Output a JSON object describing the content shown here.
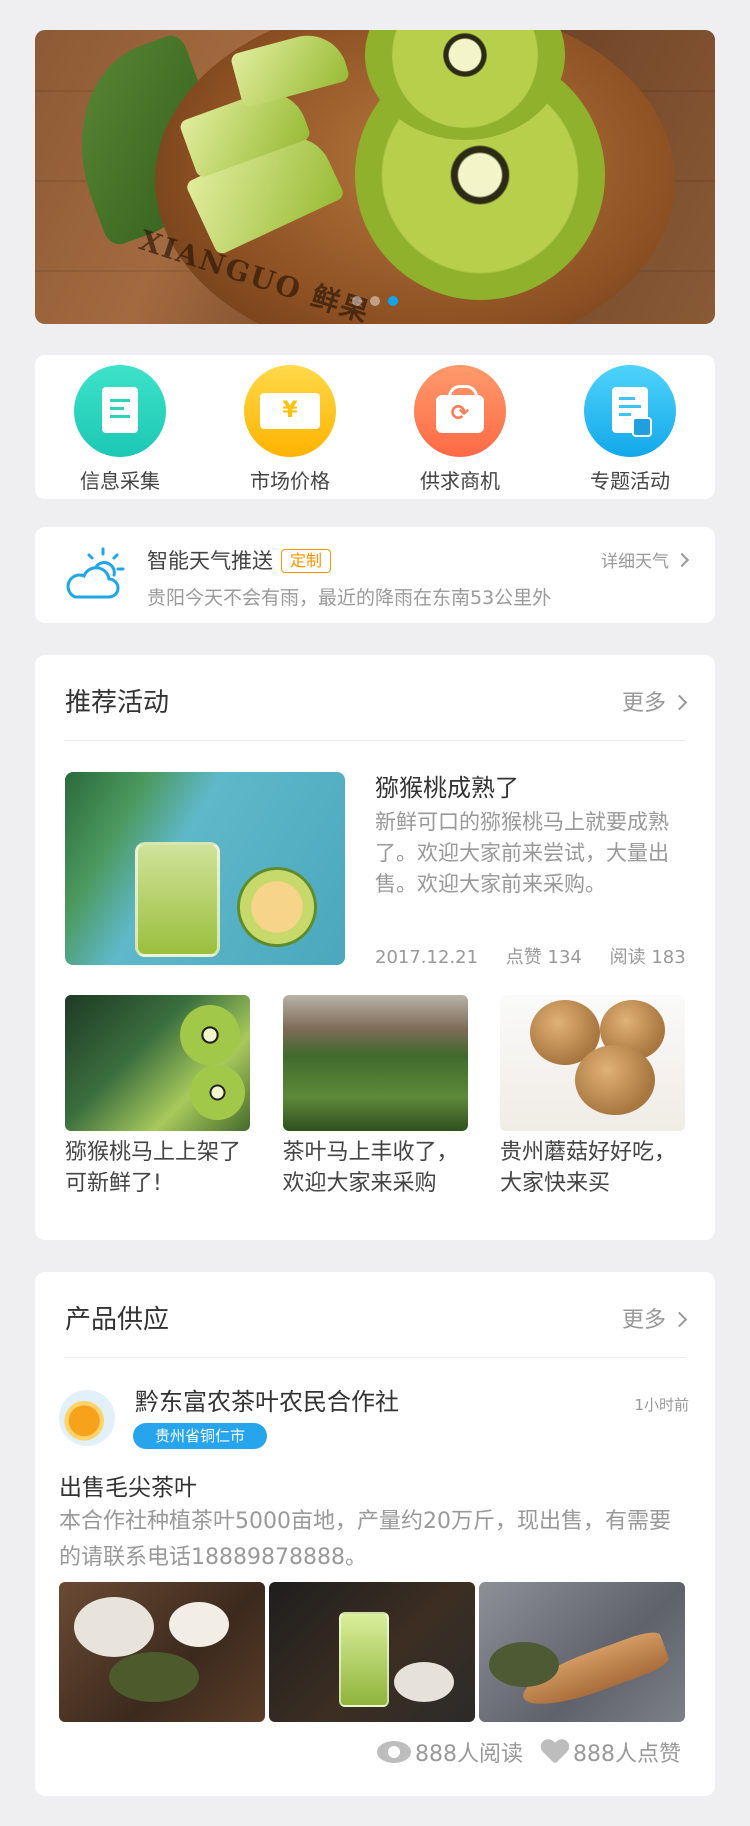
{
  "banner": {
    "brand_text": "XIANGUO 鲜果",
    "slides": 3,
    "active_slide": 3
  },
  "quick_entries": [
    {
      "label": "信息采集",
      "icon": "document-icon",
      "color": "#2fd6c1"
    },
    {
      "label": "市场价格",
      "icon": "yen-ticket-icon",
      "color": "#ffc51a"
    },
    {
      "label": "供求商机",
      "icon": "shopping-bag-icon",
      "color": "#ff7f57"
    },
    {
      "label": "专题活动",
      "icon": "edit-sheet-icon",
      "color": "#25b9f0"
    }
  ],
  "weather": {
    "title": "智能天气推送",
    "tag": "定制",
    "subtitle": "贵阳今天不会有雨，最近的降雨在东南53公里外",
    "more": "详细天气"
  },
  "recommend": {
    "title": "推荐活动",
    "more": "更多",
    "featured": {
      "title": "猕猴桃成熟了",
      "desc": "新鲜可口的猕猴桃马上就要成熟了。欢迎大家前来尝试，大量出售。欢迎大家前来采购。",
      "date": "2017.12.21",
      "likes": "点赞 134",
      "reads": "阅读 183"
    },
    "items": [
      {
        "caption": "猕猴桃马上上架了可新鲜了!"
      },
      {
        "caption": "茶叶马上丰收了，欢迎大家来采购"
      },
      {
        "caption": "贵州蘑菇好好吃，大家快来买"
      }
    ]
  },
  "supply": {
    "title": "产品供应",
    "more": "更多",
    "post": {
      "org": "黔东富农茶叶农民合作社",
      "location": "贵州省铜仁市",
      "time": "1小时前",
      "title": "出售毛尖茶叶",
      "body": "本合作社种植茶叶5000亩地，产量约20万斤，现出售，有需要的请联系电话18889878888。",
      "reads": "888人阅读",
      "likes": "888人点赞"
    }
  },
  "colors": {
    "accent": "#12a4e8",
    "tag_orange": "#ff9500",
    "location_badge": "#27a5ec"
  }
}
